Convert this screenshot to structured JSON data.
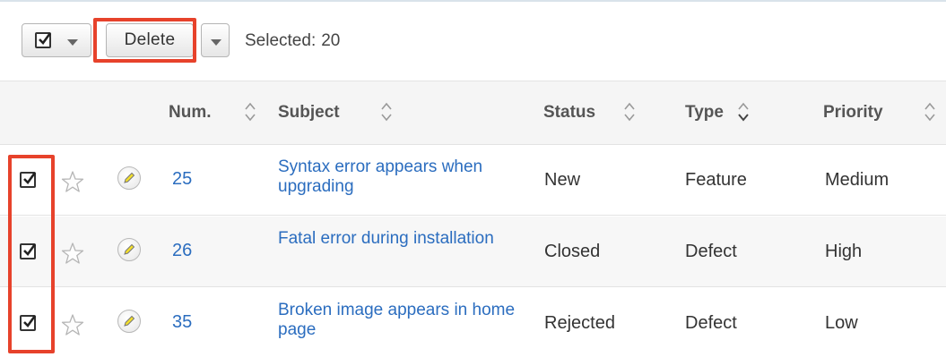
{
  "toolbar": {
    "select_all_icon": "checkbox-checked-icon",
    "delete_label": "Delete",
    "selected_label": "Selected:",
    "selected_count": "20"
  },
  "columns": {
    "num": "Num.",
    "subject": "Subject",
    "status": "Status",
    "type": "Type",
    "priority": "Priority"
  },
  "rows": [
    {
      "num": "25",
      "subject": "Syntax error appears when upgrading",
      "status": "New",
      "type": "Feature",
      "priority": "Medium",
      "checked": true
    },
    {
      "num": "26",
      "subject": "Fatal error during installation",
      "status": "Closed",
      "type": "Defect",
      "priority": "High",
      "checked": true
    },
    {
      "num": "35",
      "subject": "Broken image appears in home page",
      "status": "Rejected",
      "type": "Defect",
      "priority": "Low",
      "checked": true
    }
  ],
  "colors": {
    "link": "#2b6dbf",
    "highlight": "#e7422b",
    "header_bg": "#f5f5f5"
  }
}
